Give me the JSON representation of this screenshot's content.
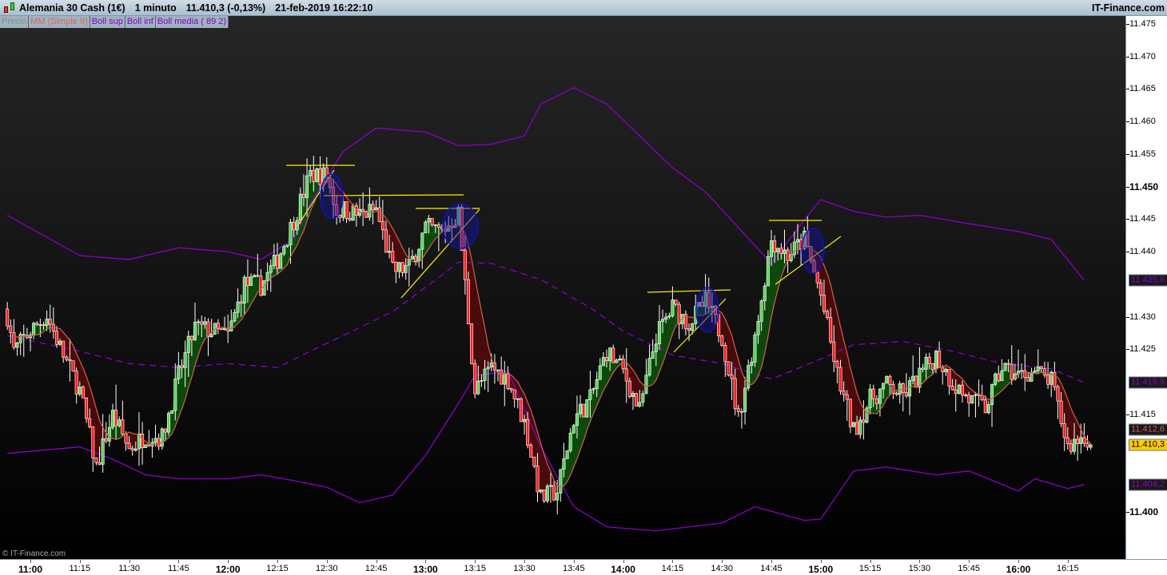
{
  "header": {
    "instrument": "Alemania 30 Cash (1€)",
    "timeframe": "1 minuto",
    "last_price": "11.410,3 (-0,13%)",
    "datetime": "21-feb-2019 16:22:10",
    "brand": "IT-Finance.com"
  },
  "legend": [
    {
      "label": "Precio",
      "color": "#8a8a8a"
    },
    {
      "label": "MM (Simple 9)",
      "color": "#e06060"
    },
    {
      "label": "Boll sup",
      "color": "#8a00d0"
    },
    {
      "label": "Boll inf",
      "color": "#8a00d0"
    },
    {
      "label": "Boll media ( 89 2)",
      "color": "#8a00d0"
    }
  ],
  "copyright": "© IT-Finance.com",
  "colors": {
    "up": "#5fd35f",
    "down": "#ff2020",
    "wick": "#ffffff",
    "mm": "#d0604f",
    "boll": "#8a00cc",
    "fill_up": "#0c4a0c",
    "fill_down": "#4a0b0b",
    "annotation": "#ffee00",
    "circle": "#1010c0",
    "price_tag": "#ffcc00"
  },
  "chart_data": {
    "type": "candlestick",
    "ylim": [
      11393,
      11477
    ],
    "y_ticks": [
      {
        "v": 11475,
        "l": "11.475"
      },
      {
        "v": 11470,
        "l": "11.470"
      },
      {
        "v": 11465,
        "l": "11.465"
      },
      {
        "v": 11460,
        "l": "11.460"
      },
      {
        "v": 11455,
        "l": "11.455"
      },
      {
        "v": 11450,
        "l": "11.450",
        "bold": true
      },
      {
        "v": 11445,
        "l": "11.445"
      },
      {
        "v": 11440,
        "l": "11.440"
      },
      {
        "v": 11430,
        "l": "11.430"
      },
      {
        "v": 11425,
        "l": "11.425"
      },
      {
        "v": 11415,
        "l": "11.415"
      },
      {
        "v": 11400,
        "l": "11.400",
        "bold": true
      }
    ],
    "x_ticks": [
      {
        "t": "11:00",
        "bold": true
      },
      {
        "t": "11:15"
      },
      {
        "t": "11:30"
      },
      {
        "t": "11:45"
      },
      {
        "t": "12:00",
        "bold": true
      },
      {
        "t": "12:15"
      },
      {
        "t": "12:30"
      },
      {
        "t": "12:45"
      },
      {
        "t": "13:00",
        "bold": true
      },
      {
        "t": "13:15"
      },
      {
        "t": "13:30"
      },
      {
        "t": "13:45"
      },
      {
        "t": "14:00",
        "bold": true
      },
      {
        "t": "14:15"
      },
      {
        "t": "14:30"
      },
      {
        "t": "14:45"
      },
      {
        "t": "15:00",
        "bold": true
      },
      {
        "t": "15:15"
      },
      {
        "t": "15:30"
      },
      {
        "t": "15:45"
      },
      {
        "t": "16:00",
        "bold": true
      },
      {
        "t": "16:15"
      }
    ],
    "close": [
      [
        "10:53",
        11430.2
      ],
      [
        "10:55",
        11424.7
      ],
      [
        "11:00",
        11427.8
      ],
      [
        "11:05",
        11430.2
      ],
      [
        "11:10",
        11424.1
      ],
      [
        "11:15",
        11418.6
      ],
      [
        "11:20",
        11406.9
      ],
      [
        "11:25",
        11414.9
      ],
      [
        "11:30",
        11409.7
      ],
      [
        "11:35",
        11411.8
      ],
      [
        "11:40",
        11411.4
      ],
      [
        "11:45",
        11421.0
      ],
      [
        "11:50",
        11428.4
      ],
      [
        "11:55",
        11427.8
      ],
      [
        "12:00",
        11427.1
      ],
      [
        "12:05",
        11435.1
      ],
      [
        "12:10",
        11434.8
      ],
      [
        "12:15",
        11438.8
      ],
      [
        "12:20",
        11444.9
      ],
      [
        "12:25",
        11451.9
      ],
      [
        "12:30",
        11451.7
      ],
      [
        "12:33",
        11446.2
      ],
      [
        "12:35",
        11446.5
      ],
      [
        "12:40",
        11445.6
      ],
      [
        "12:45",
        11446.5
      ],
      [
        "12:50",
        11437.0
      ],
      [
        "12:55",
        11437.6
      ],
      [
        "13:00",
        11443.7
      ],
      [
        "13:05",
        11443.1
      ],
      [
        "13:10",
        11445.8
      ],
      [
        "13:13",
        11429.6
      ],
      [
        "13:15",
        11418.6
      ],
      [
        "13:20",
        11422.2
      ],
      [
        "13:25",
        11420.4
      ],
      [
        "13:30",
        11413.7
      ],
      [
        "13:35",
        11402.0
      ],
      [
        "13:40",
        11403.2
      ],
      [
        "13:45",
        11414.3
      ],
      [
        "13:50",
        11417.3
      ],
      [
        "13:55",
        11424.7
      ],
      [
        "14:00",
        11421.6
      ],
      [
        "14:05",
        11415.5
      ],
      [
        "14:10",
        11427.1
      ],
      [
        "14:15",
        11431.4
      ],
      [
        "14:20",
        11429.0
      ],
      [
        "14:25",
        11432.3
      ],
      [
        "14:30",
        11427.1
      ],
      [
        "14:35",
        11414.3
      ],
      [
        "14:40",
        11427.1
      ],
      [
        "14:45",
        11441.9
      ],
      [
        "14:50",
        11439.4
      ],
      [
        "14:55",
        11441.9
      ],
      [
        "15:00",
        11433.3
      ],
      [
        "15:05",
        11421.0
      ],
      [
        "15:10",
        11412.4
      ],
      [
        "15:15",
        11417.3
      ],
      [
        "15:20",
        11419.5
      ],
      [
        "15:25",
        11417.9
      ],
      [
        "15:30",
        11421.0
      ],
      [
        "15:35",
        11424.1
      ],
      [
        "15:40",
        11419.8
      ],
      [
        "15:45",
        11417.3
      ],
      [
        "15:50",
        11415.9
      ],
      [
        "15:55",
        11422.2
      ],
      [
        "16:00",
        11421.0
      ],
      [
        "16:05",
        11421.6
      ],
      [
        "16:10",
        11420.0
      ],
      [
        "16:15",
        11410.0
      ],
      [
        "16:20",
        11411.8
      ],
      [
        "16:22",
        11410.3
      ]
    ],
    "boll_sup": [
      [
        "10:53",
        11445.6
      ],
      [
        "11:15",
        11439.4
      ],
      [
        "11:30",
        11438.8
      ],
      [
        "11:45",
        11440.6
      ],
      [
        "12:00",
        11440.0
      ],
      [
        "12:10",
        11438.8
      ],
      [
        "12:20",
        11441.9
      ],
      [
        "12:25",
        11447.4
      ],
      [
        "12:35",
        11455.4
      ],
      [
        "12:45",
        11459.0
      ],
      [
        "13:00",
        11458.4
      ],
      [
        "13:10",
        11456.3
      ],
      [
        "13:20",
        11456.5
      ],
      [
        "13:30",
        11457.8
      ],
      [
        "13:35",
        11462.7
      ],
      [
        "13:45",
        11465.2
      ],
      [
        "13:55",
        11462.7
      ],
      [
        "14:05",
        11457.8
      ],
      [
        "14:15",
        11452.9
      ],
      [
        "14:25",
        11449.2
      ],
      [
        "14:35",
        11443.7
      ],
      [
        "14:45",
        11438.2
      ],
      [
        "14:55",
        11444.9
      ],
      [
        "15:00",
        11448.0
      ],
      [
        "15:10",
        11446.2
      ],
      [
        "15:20",
        11445.3
      ],
      [
        "15:30",
        11445.6
      ],
      [
        "15:45",
        11444.3
      ],
      [
        "16:00",
        11443.1
      ],
      [
        "16:10",
        11441.9
      ],
      [
        "16:20",
        11435.6
      ]
    ],
    "boll_inf": [
      [
        "10:53",
        11409.0
      ],
      [
        "11:15",
        11410.0
      ],
      [
        "11:25",
        11408.1
      ],
      [
        "11:35",
        11405.7
      ],
      [
        "11:45",
        11405.1
      ],
      [
        "12:00",
        11405.1
      ],
      [
        "12:10",
        11405.7
      ],
      [
        "12:20",
        11404.8
      ],
      [
        "12:30",
        11403.8
      ],
      [
        "12:40",
        11401.4
      ],
      [
        "12:50",
        11402.6
      ],
      [
        "13:00",
        11408.7
      ],
      [
        "13:10",
        11416.7
      ],
      [
        "13:15",
        11421.0
      ],
      [
        "13:25",
        11421.6
      ],
      [
        "13:35",
        11410.0
      ],
      [
        "13:45",
        11400.8
      ],
      [
        "13:55",
        11397.7
      ],
      [
        "14:10",
        11397.1
      ],
      [
        "14:20",
        11397.7
      ],
      [
        "14:30",
        11398.3
      ],
      [
        "14:40",
        11400.8
      ],
      [
        "14:55",
        11398.7
      ],
      [
        "15:00",
        11398.9
      ],
      [
        "15:05",
        11402.6
      ],
      [
        "15:10",
        11406.3
      ],
      [
        "15:20",
        11406.9
      ],
      [
        "15:35",
        11405.7
      ],
      [
        "15:45",
        11406.3
      ],
      [
        "16:00",
        11403.2
      ],
      [
        "16:05",
        11405.1
      ],
      [
        "16:15",
        11403.6
      ],
      [
        "16:20",
        11404.2
      ]
    ],
    "boll_media": [
      [
        "10:53",
        11427.1
      ],
      [
        "11:15",
        11424.7
      ],
      [
        "11:30",
        11422.8
      ],
      [
        "11:45",
        11422.2
      ],
      [
        "12:00",
        11422.8
      ],
      [
        "12:15",
        11422.2
      ],
      [
        "12:25",
        11424.7
      ],
      [
        "12:35",
        11427.1
      ],
      [
        "12:50",
        11430.8
      ],
      [
        "13:05",
        11436.4
      ],
      [
        "13:10",
        11438.4
      ],
      [
        "13:20",
        11438.2
      ],
      [
        "13:35",
        11435.7
      ],
      [
        "13:50",
        11431.4
      ],
      [
        "14:00",
        11427.8
      ],
      [
        "14:15",
        11424.1
      ],
      [
        "14:30",
        11422.8
      ],
      [
        "14:45",
        11420.4
      ],
      [
        "15:00",
        11423.5
      ],
      [
        "15:10",
        11425.7
      ],
      [
        "15:25",
        11426.2
      ],
      [
        "15:40",
        11424.7
      ],
      [
        "15:55",
        11422.8
      ],
      [
        "16:10",
        11422.0
      ],
      [
        "16:20",
        11419.9
      ]
    ],
    "mm_period": 9,
    "price_tags": [
      {
        "label": "11.435,6",
        "value": 11435.6,
        "series": "Boll sup"
      },
      {
        "label": "11.419,9",
        "value": 11419.9,
        "series": "Boll media"
      },
      {
        "label": "11.412,6",
        "value": 11412.6,
        "series": "MM (Simple 9)"
      },
      {
        "label": "11.410,3",
        "value": 11410.3,
        "series": "Precio"
      },
      {
        "label": "11.404,2",
        "value": 11404.2,
        "series": "Boll inf"
      }
    ]
  }
}
